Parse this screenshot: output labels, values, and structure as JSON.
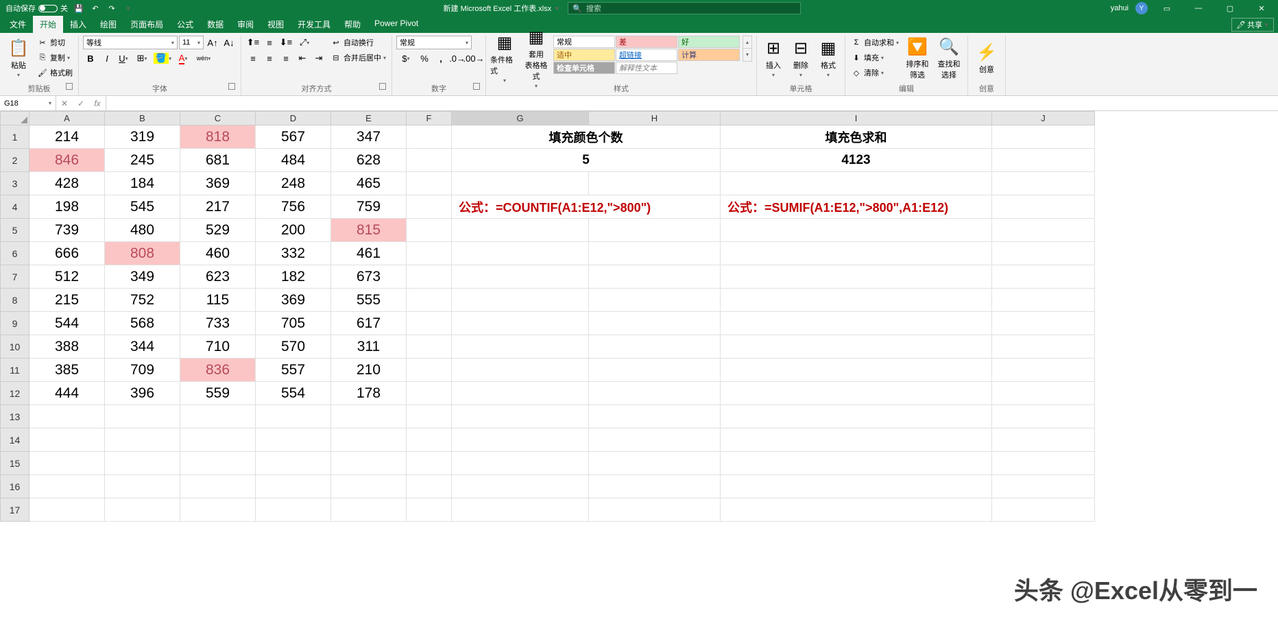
{
  "titlebar": {
    "auto_save": "自动保存",
    "auto_save_state": "关",
    "filename": "新建 Microsoft Excel 工作表.xlsx",
    "search_placeholder": "搜索",
    "username": "yahui",
    "avatar_initial": "Y"
  },
  "tabs": {
    "items": [
      "文件",
      "开始",
      "插入",
      "绘图",
      "页面布局",
      "公式",
      "数据",
      "审阅",
      "视图",
      "开发工具",
      "帮助",
      "Power Pivot"
    ],
    "active_index": 1,
    "share": "共享"
  },
  "ribbon": {
    "clipboard": {
      "paste": "粘贴",
      "cut": "剪切",
      "copy": "复制",
      "format_painter": "格式刷",
      "label": "剪贴板"
    },
    "font": {
      "name": "等线",
      "size": "11",
      "pinyin": "wén",
      "label": "字体"
    },
    "alignment": {
      "wrap": "自动换行",
      "merge": "合并后居中",
      "label": "对齐方式"
    },
    "number": {
      "format": "常规",
      "label": "数字"
    },
    "styles": {
      "cond_format": "条件格式",
      "table_format": "套用\n表格格式",
      "normal": "常规",
      "bad": "差",
      "good": "好",
      "neutral": "适中",
      "link": "超链接",
      "calc": "计算",
      "check": "检查单元格",
      "explain": "解释性文本",
      "label": "样式"
    },
    "cells": {
      "insert": "插入",
      "delete": "删除",
      "format": "格式",
      "label": "单元格"
    },
    "editing": {
      "autosum": "自动求和",
      "fill": "填充",
      "clear": "清除",
      "sort": "排序和筛选",
      "find": "查找和选择",
      "label": "编辑"
    },
    "ideas": {
      "ideas": "创意",
      "label": "创意"
    }
  },
  "formula_bar": {
    "name_box": "G18",
    "formula": ""
  },
  "grid": {
    "columns": [
      "A",
      "B",
      "C",
      "D",
      "E",
      "F",
      "G",
      "H",
      "I",
      "J"
    ],
    "active_col": "G",
    "row_count": 17,
    "active_row": -1,
    "selected_cell": {
      "row": 18,
      "col": "G"
    },
    "data": {
      "1": {
        "A": "214",
        "B": "319",
        "C": "818",
        "D": "567",
        "E": "347"
      },
      "2": {
        "A": "846",
        "B": "245",
        "C": "681",
        "D": "484",
        "E": "628"
      },
      "3": {
        "A": "428",
        "B": "184",
        "C": "369",
        "D": "248",
        "E": "465"
      },
      "4": {
        "A": "198",
        "B": "545",
        "C": "217",
        "D": "756",
        "E": "759"
      },
      "5": {
        "A": "739",
        "B": "480",
        "C": "529",
        "D": "200",
        "E": "815"
      },
      "6": {
        "A": "666",
        "B": "808",
        "C": "460",
        "D": "332",
        "E": "461"
      },
      "7": {
        "A": "512",
        "B": "349",
        "C": "623",
        "D": "182",
        "E": "673"
      },
      "8": {
        "A": "215",
        "B": "752",
        "C": "115",
        "D": "369",
        "E": "555"
      },
      "9": {
        "A": "544",
        "B": "568",
        "C": "733",
        "D": "705",
        "E": "617"
      },
      "10": {
        "A": "388",
        "B": "344",
        "C": "710",
        "D": "570",
        "E": "311"
      },
      "11": {
        "A": "385",
        "B": "709",
        "C": "836",
        "D": "557",
        "E": "210"
      },
      "12": {
        "A": "444",
        "B": "396",
        "C": "559",
        "D": "554",
        "E": "178"
      }
    },
    "highlights": [
      {
        "row": 1,
        "col": "C"
      },
      {
        "row": 2,
        "col": "A"
      },
      {
        "row": 5,
        "col": "E"
      },
      {
        "row": 6,
        "col": "B"
      },
      {
        "row": 11,
        "col": "C"
      }
    ],
    "annotations": {
      "g1": "填充颜色个数",
      "g2": "5",
      "i1": "填充色求和",
      "i2": "4123",
      "g4": "公式：=COUNTIF(A1:E12,\">800\")",
      "i4": "公式：=SUMIF(A1:E12,\">800\",A1:E12)"
    }
  },
  "watermark": "头条 @Excel从零到一"
}
